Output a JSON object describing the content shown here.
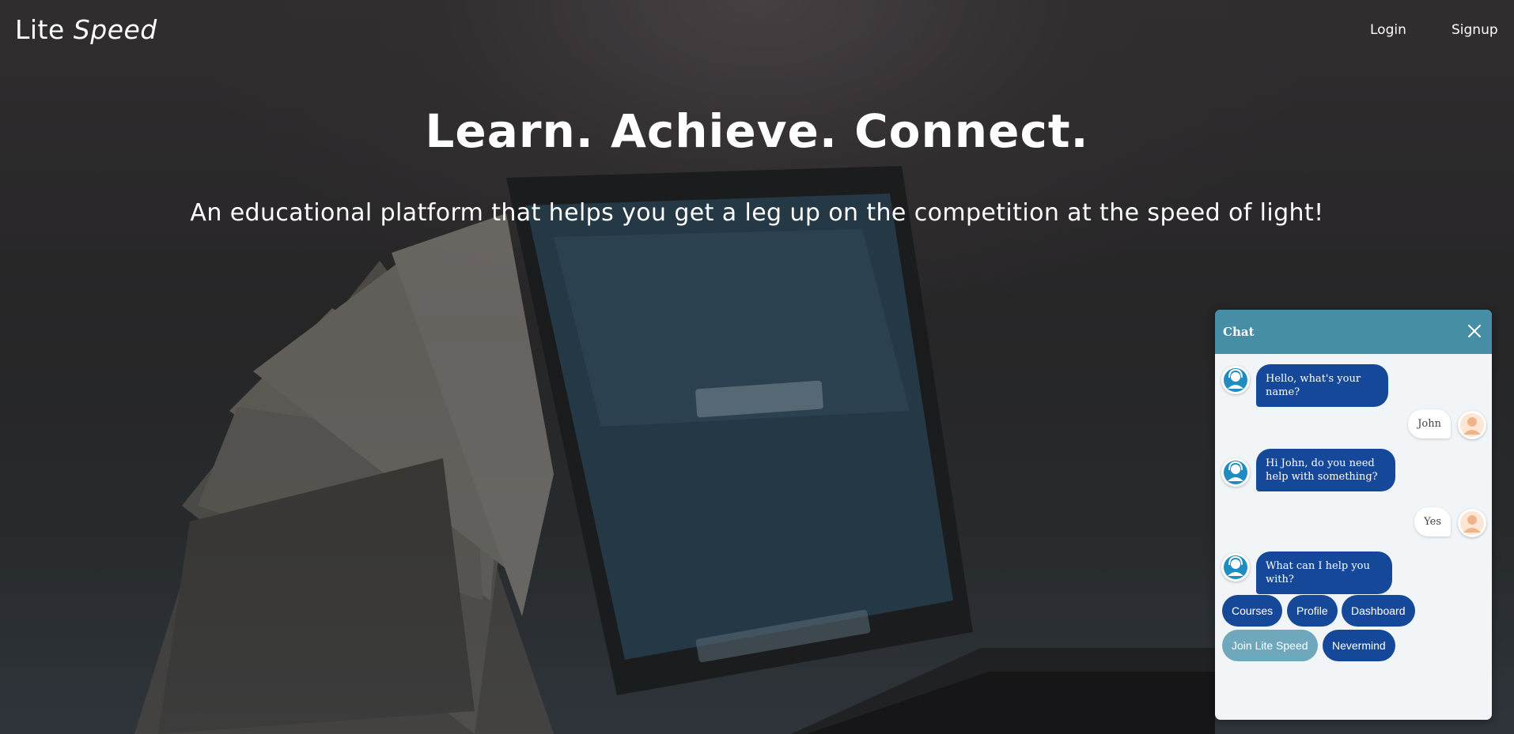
{
  "navbar": {
    "brand_part1": "Lite",
    "brand_part2": "Speed",
    "login_label": "Login",
    "signup_label": "Signup"
  },
  "hero": {
    "title": "Learn. Achieve. Connect.",
    "subtitle": "An educational platform that helps you get a leg up on the competition at the speed of light!"
  },
  "chat": {
    "title": "Chat",
    "header_color": "#458ea5",
    "bot_bubble_color": "#16489a",
    "messages": [
      {
        "from": "bot",
        "text": "Hello, what's your name?"
      },
      {
        "from": "user",
        "text": "John"
      },
      {
        "from": "bot",
        "text": "Hi John, do you need help with something?"
      },
      {
        "from": "user",
        "text": "Yes"
      },
      {
        "from": "bot",
        "text": "What can I help you with?"
      }
    ],
    "quick_replies": [
      {
        "label": "Courses"
      },
      {
        "label": "Profile"
      },
      {
        "label": "Dashboard"
      },
      {
        "label": "Join Lite Speed"
      },
      {
        "label": "Nevermind"
      }
    ]
  },
  "icons": {
    "close": "close-icon",
    "bot_avatar": "support-agent-icon",
    "user_avatar": "user-avatar-icon"
  }
}
